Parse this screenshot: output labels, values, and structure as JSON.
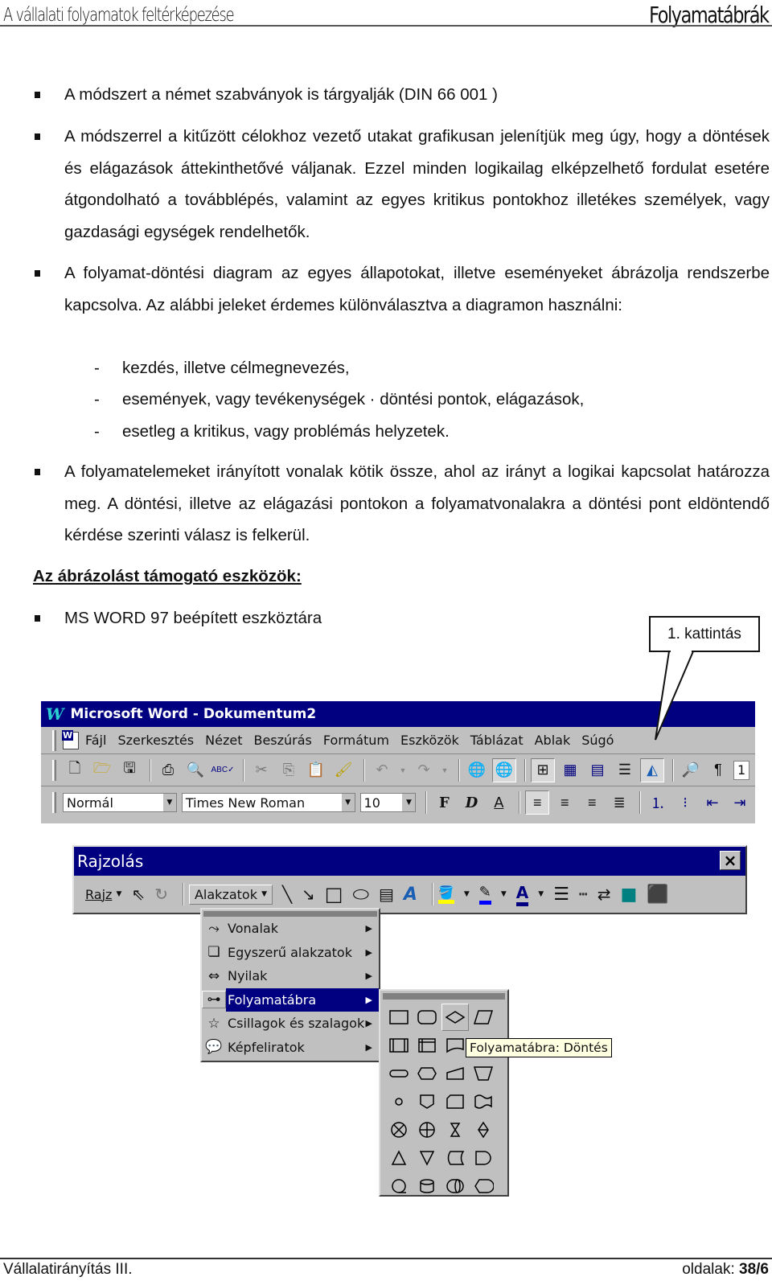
{
  "header": {
    "left_title": "A vállalati folyamatok feltérképezése",
    "right_title": "Folyamatábrák"
  },
  "body": {
    "bullets": [
      "A módszert a német szabványok is tárgyalják (DIN 66 001 )",
      "A módszerrel a kitűzött célokhoz vezető utakat grafikusan jelenítjük meg úgy, hogy a döntések és elágazások áttekinthetővé váljanak. Ezzel minden logikailag elképzelhető fordulat esetére átgondolható a továbblépés, valamint az egyes kritikus pontokhoz illetékes személyek, vagy gazdasági egységek rendelhetők.",
      "A folyamat-döntési diagram az egyes állapotokat, illetve eseményeket ábrázolja rendszerbe kapcsolva. Az alábbi jeleket érdemes különválasztva a diagramon használni:",
      "A folyamatelemeket irányított vonalak kötik össze, ahol az irányt a logikai kapcsolat határozza meg. A döntési, illetve az elágazási pontokon a folyamatvonalakra a döntési pont eldöntendő kérdése szerinti válasz is felkerül."
    ],
    "sub_items": [
      "kezdés, illetve célmegnevezés,",
      "események, vagy tevékenységek · döntési pontok, elágazások,",
      "esetleg a kritikus, vagy problémás helyzetek."
    ],
    "dash": "-",
    "section_title": "Az ábrázolást támogató eszközök:",
    "tools_bullet": "MS WORD 97 beépített eszköztára",
    "callout": "1. kattintás"
  },
  "word_window": {
    "title": "Microsoft Word - Dokumentum2",
    "logo": "W",
    "menu": [
      "Fájl",
      "Szerkesztés",
      "Nézet",
      "Beszúrás",
      "Formátum",
      "Eszközök",
      "Táblázat",
      "Ablak",
      "Súgó"
    ],
    "style_value": "Normál",
    "font_value": "Times New Roman",
    "size_value": "10",
    "zoom_value": "1",
    "bold_label": "F",
    "italic_label": "D",
    "underline_label": "A"
  },
  "drawing_toolbar": {
    "title": "Rajzolás",
    "close": "×",
    "rajz_label": "Rajz",
    "shapes_label": "Alakzatok",
    "fill_color": "#ffff00",
    "line_color": "#0000ff",
    "font_color": "#000080"
  },
  "shapes_menu": {
    "items": [
      {
        "label": "Vonalak",
        "icon": "lines-icon"
      },
      {
        "label": "Egyszerű alakzatok",
        "icon": "basic-shapes-icon"
      },
      {
        "label": "Nyilak",
        "icon": "arrows-icon"
      },
      {
        "label": "Folyamatábra",
        "icon": "flowchart-icon",
        "active": true
      },
      {
        "label": "Csillagok és szalagok",
        "icon": "stars-banners-icon"
      },
      {
        "label": "Képfeliratok",
        "icon": "callouts-icon"
      }
    ]
  },
  "flowchart_palette": {
    "tooltip": "Folyamatábra: Döntés",
    "hovered_shape": "decision"
  },
  "footer": {
    "left": "Vállalatirányítás III.",
    "pages_label": "oldalak:",
    "pages_value": "38/6"
  }
}
